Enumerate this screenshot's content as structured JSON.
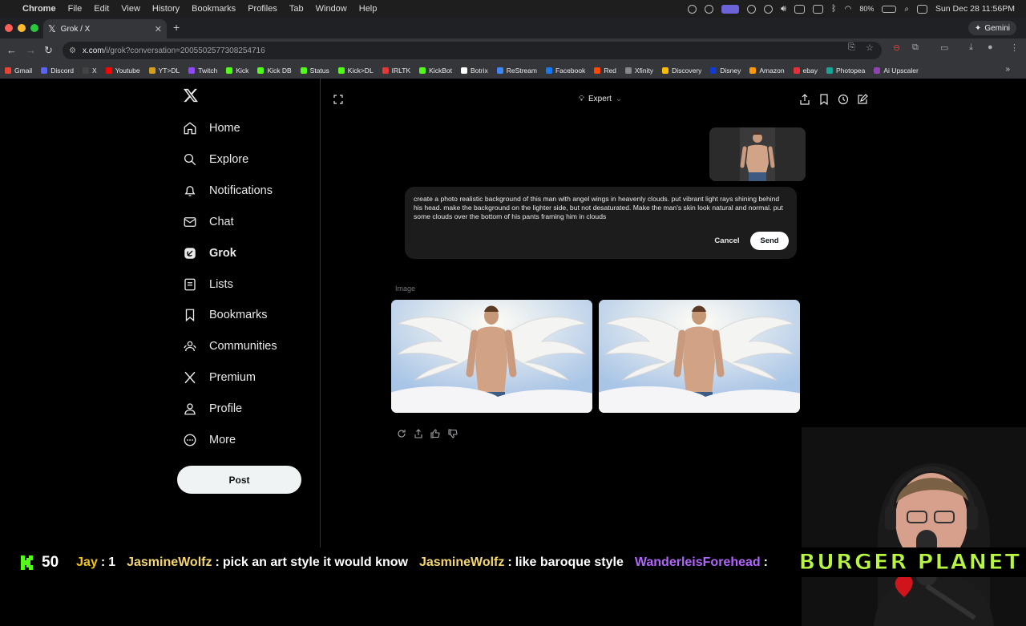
{
  "menubar": {
    "app": "Chrome",
    "items": [
      "File",
      "Edit",
      "View",
      "History",
      "Bookmarks",
      "Profiles",
      "Tab",
      "Window",
      "Help"
    ],
    "battery": "80%",
    "clock": "Sun Dec 28  11:56PM"
  },
  "browser": {
    "tab_title": "Grok / X",
    "gemini_label": "Gemini",
    "url_host": "x.com",
    "url_path": "/i/grok?conversation=2005502577308254716"
  },
  "bookmarks": [
    {
      "label": "Gmail",
      "color": "#ea4335"
    },
    {
      "label": "Discord",
      "color": "#5865f2"
    },
    {
      "label": "X",
      "color": "#444444"
    },
    {
      "label": "Youtube",
      "color": "#ff0000"
    },
    {
      "label": "YT>DL",
      "color": "#d4a017"
    },
    {
      "label": "Twitch",
      "color": "#9146ff"
    },
    {
      "label": "Kick",
      "color": "#53fc18"
    },
    {
      "label": "Kick DB",
      "color": "#53fc18"
    },
    {
      "label": "Status",
      "color": "#53fc18"
    },
    {
      "label": "Kick>DL",
      "color": "#53fc18"
    },
    {
      "label": "IRLTK",
      "color": "#e53935"
    },
    {
      "label": "KickBot",
      "color": "#53fc18"
    },
    {
      "label": "Botrix",
      "color": "#ffffff"
    },
    {
      "label": "ReStream",
      "color": "#4285f4"
    },
    {
      "label": "Facebook",
      "color": "#1877f2"
    },
    {
      "label": "Red",
      "color": "#ff4500"
    },
    {
      "label": "Xfinity",
      "color": "#888888"
    },
    {
      "label": "Discovery",
      "color": "#fbbc04"
    },
    {
      "label": "Disney",
      "color": "#113ccf"
    },
    {
      "label": "Amazon",
      "color": "#ff9900"
    },
    {
      "label": "ebay",
      "color": "#e53238"
    },
    {
      "label": "Photopea",
      "color": "#18a497"
    },
    {
      "label": "Ai Upscaler",
      "color": "#8e44ad"
    }
  ],
  "sidebar": {
    "items": [
      {
        "label": "Home",
        "icon": "home-icon"
      },
      {
        "label": "Explore",
        "icon": "search-icon"
      },
      {
        "label": "Notifications",
        "icon": "bell-icon"
      },
      {
        "label": "Chat",
        "icon": "mail-icon"
      },
      {
        "label": "Grok",
        "icon": "grok-icon",
        "active": true
      },
      {
        "label": "Lists",
        "icon": "list-icon"
      },
      {
        "label": "Bookmarks",
        "icon": "bookmark-icon"
      },
      {
        "label": "Communities",
        "icon": "people-icon"
      },
      {
        "label": "Premium",
        "icon": "x-icon"
      },
      {
        "label": "Profile",
        "icon": "person-icon"
      },
      {
        "label": "More",
        "icon": "more-icon"
      }
    ],
    "post_label": "Post"
  },
  "grok": {
    "model_label": "Expert",
    "prompt_text": "create a photo realistic background of this man with angel wings in heavenly clouds. put vibrant light rays shining behind his head. make the background on the lighter side, but not desaturated. Make the man's skin look natural and normal. put some clouds over the bottom of his pants framing him in clouds",
    "cancel_label": "Cancel",
    "send_label": "Send",
    "image_label": "Image"
  },
  "ticker": {
    "kick_count": "50",
    "messages": [
      {
        "user": "Jay",
        "text": "1",
        "color": "#f0c419"
      },
      {
        "user": "JasmineWolfz",
        "text": "pick an art style it would know",
        "color": "#f5d76e"
      },
      {
        "user": "JasmineWolfz",
        "text": "like baroque style",
        "color": "#f5d76e"
      },
      {
        "user": "WanderleisForehead",
        "text": "",
        "color": "#b264ff"
      }
    ],
    "brand": "BURGER PLANET"
  }
}
